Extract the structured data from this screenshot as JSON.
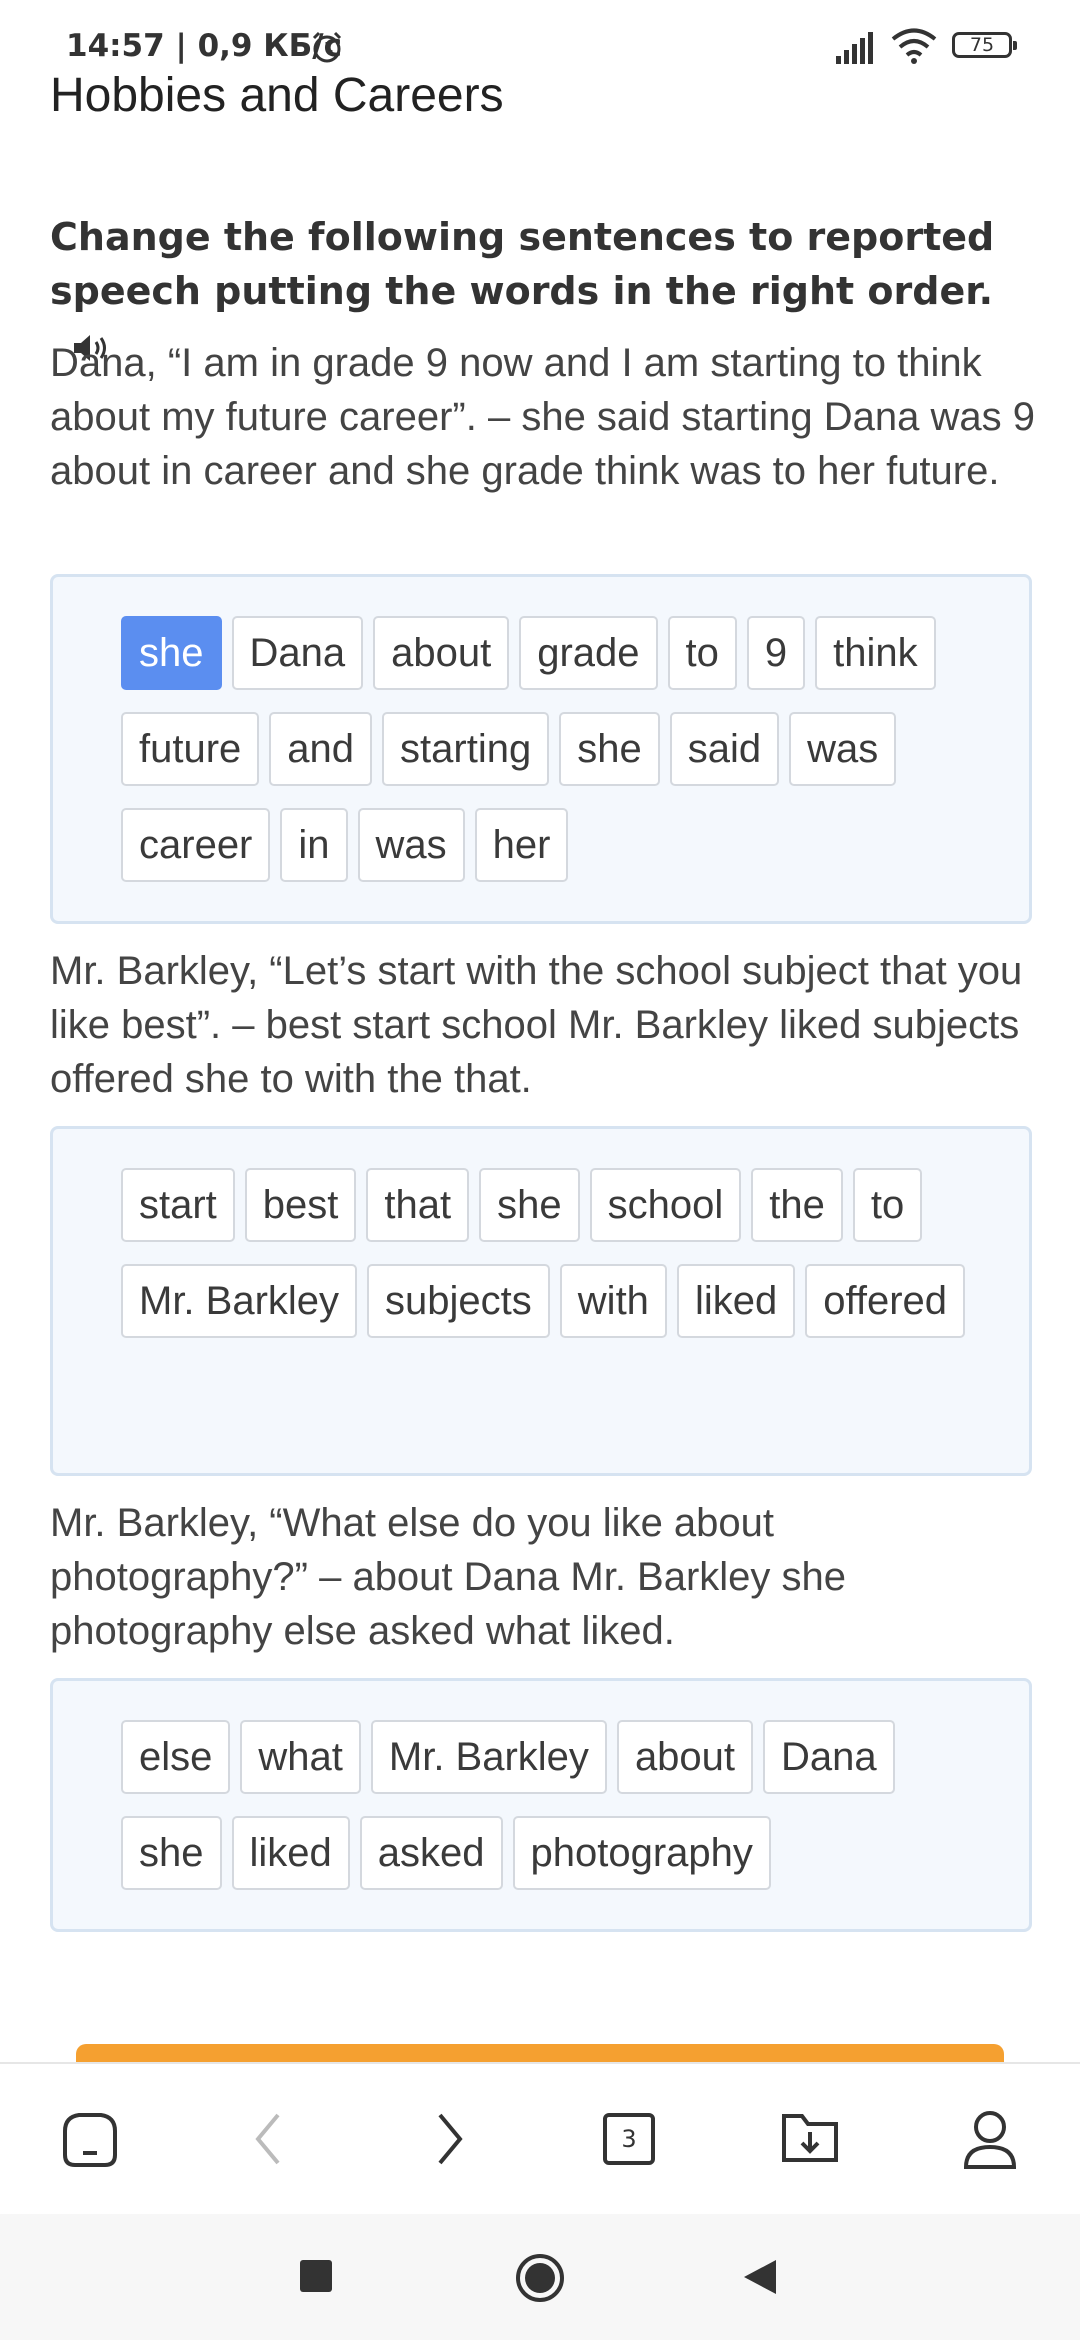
{
  "status_bar": {
    "time_text": "14:57 | 0,9 КБ/с",
    "battery_level": "75",
    "icons": [
      "alarm-icon",
      "signal-icon",
      "wifi-icon",
      "battery-icon"
    ]
  },
  "page": {
    "title": "Hobbies and Careers",
    "instruction": "Change the following sentences to reported speech putting the words in the right order."
  },
  "exercises": [
    {
      "prompt": "Dana, “I am in grade 9 now and I am starting to think about my future career”. – she said starting Dana was 9 about in career and she grade think was to her future.",
      "words": [
        "she",
        "Dana",
        "about",
        "grade",
        "to",
        "9",
        "think",
        "future",
        "and",
        "starting",
        "she",
        "said",
        "was",
        "career",
        "in",
        "was",
        "her"
      ],
      "selected_index": 0
    },
    {
      "prompt": "Mr. Barkley, “Let’s start with the school subject that you like best”. – best start school Mr. Barkley liked subjects offered she to with the that.",
      "words": [
        "start",
        "best",
        "that",
        "she",
        "school",
        "the",
        "to",
        "Mr. Barkley",
        "subjects",
        "with",
        "liked",
        "offered"
      ]
    },
    {
      "prompt": "Mr. Barkley, “What else do you like about photography?” – about Dana Mr. Barkley she photography else asked what liked.",
      "words": [
        "else",
        "what",
        "Mr. Barkley",
        "about",
        "Dana",
        "she",
        "liked",
        "asked",
        "photography"
      ]
    }
  ],
  "browser_nav": {
    "tab_count": "3",
    "icons": [
      "home-icon",
      "back-icon",
      "forward-icon",
      "tabs-icon",
      "downloads-icon",
      "profile-icon"
    ]
  },
  "system_nav": {
    "icons": [
      "recents-icon",
      "home-circle-icon",
      "back-triangle-icon"
    ]
  },
  "colors": {
    "selected_chip": "#5b8ef0",
    "panel_bg": "#f4f8fd",
    "action_button": "#f5a030"
  }
}
